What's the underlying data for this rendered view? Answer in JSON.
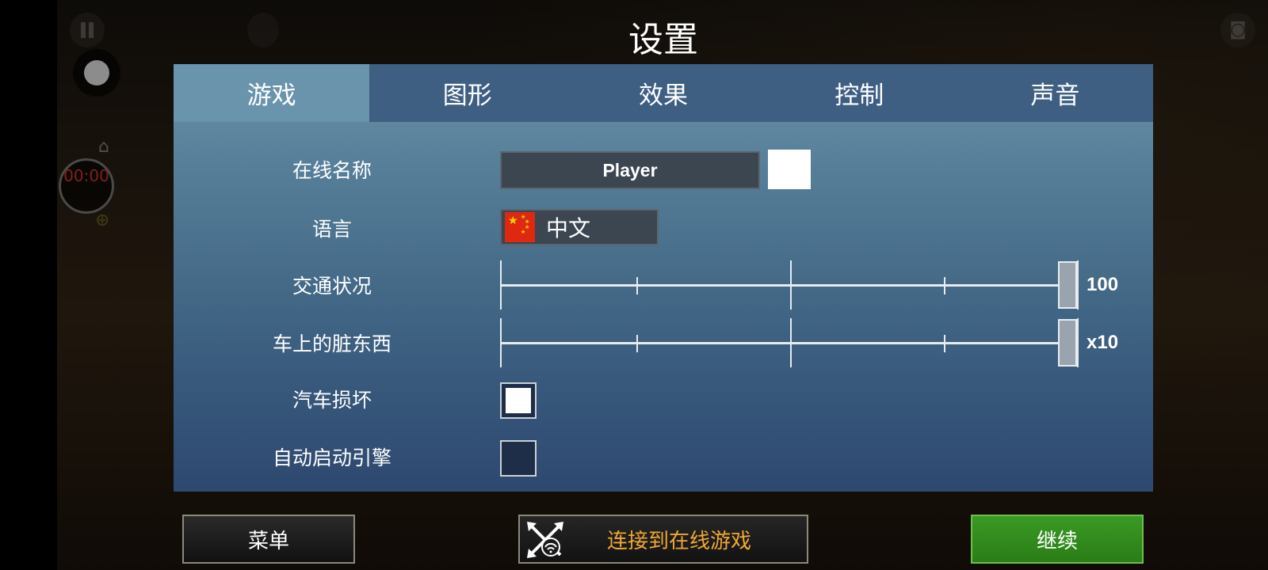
{
  "title": "设置",
  "hud": {
    "timer": "00:00",
    "home_icon": "home-icon",
    "camera_icon": "camera-icon",
    "pause_icon": "pause-icon"
  },
  "tabs": [
    {
      "label": "游戏",
      "active": true
    },
    {
      "label": "图形",
      "active": false
    },
    {
      "label": "效果",
      "active": false
    },
    {
      "label": "控制",
      "active": false
    },
    {
      "label": "声音",
      "active": false
    }
  ],
  "settings": {
    "online_name": {
      "label": "在线名称",
      "value": "Player"
    },
    "language": {
      "label": "语言",
      "value": "中文",
      "flag_icon": "china-flag-icon"
    },
    "traffic": {
      "label": "交通状况",
      "value_text": "100",
      "level": 1.0
    },
    "car_dirt": {
      "label": "车上的脏东西",
      "value_text": "x10",
      "level": 1.0
    },
    "car_damage": {
      "label": "汽车损坏",
      "checked": true
    },
    "auto_start_engine": {
      "label": "自动启动引擎",
      "checked": false
    }
  },
  "buttons": {
    "menu": "菜单",
    "connect_online": "连接到在线游戏",
    "continue": "继续"
  },
  "colors": {
    "tab_active": "#6994ab",
    "tab_bar": "#3e5f82",
    "online_button_text": "#f0a830",
    "continue_green": "#2a7d17"
  }
}
